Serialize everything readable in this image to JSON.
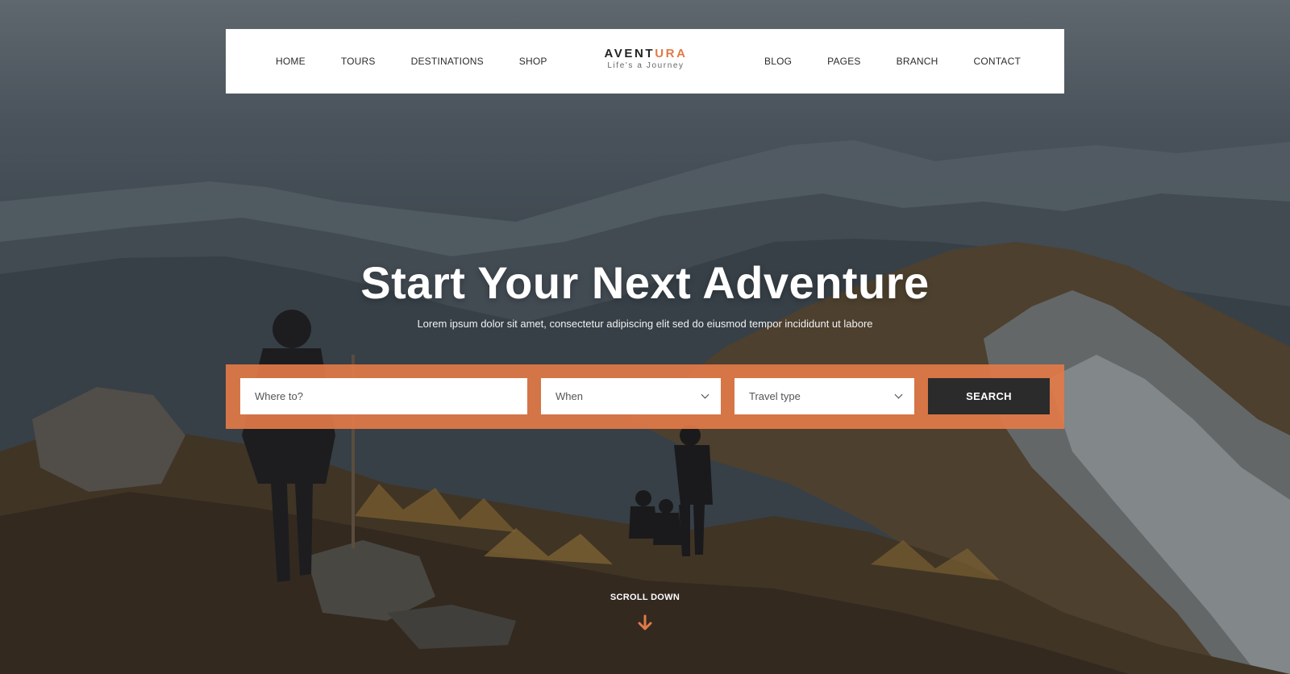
{
  "nav": {
    "left_items": [
      {
        "label": "HOME"
      },
      {
        "label": "TOURS"
      },
      {
        "label": "DESTINATIONS"
      },
      {
        "label": "SHOP"
      }
    ],
    "right_items": [
      {
        "label": "BLOG"
      },
      {
        "label": "PAGES"
      },
      {
        "label": "BRANCH"
      },
      {
        "label": "CONTACT"
      }
    ]
  },
  "logo": {
    "word_main": "AVENT",
    "word_accent": "URA",
    "tagline": "Life's a Journey"
  },
  "hero": {
    "title": "Start Your Next Adventure",
    "subtitle": "Lorem ipsum dolor sit amet, consectetur adipiscing elit sed do eiusmod tempor incididunt ut labore"
  },
  "search": {
    "where_placeholder": "Where to?",
    "when_label": "When",
    "type_label": "Travel type",
    "button_label": "SEARCH"
  },
  "scroll_down": "SCROLL DOWN",
  "colors": {
    "accent": "#e07a48",
    "button_dark": "#2b2b2b"
  }
}
